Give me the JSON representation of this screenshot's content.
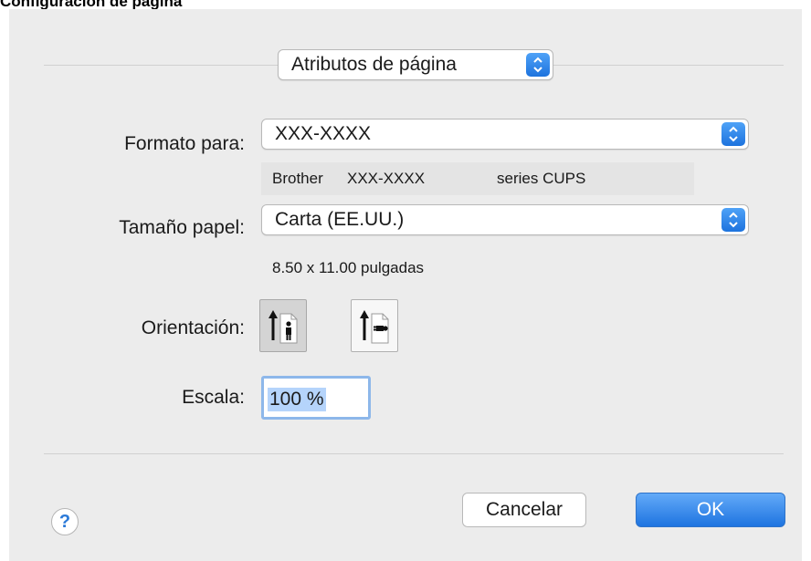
{
  "document": {
    "heading": "Configuración de página"
  },
  "dialog": {
    "attributes_popup": {
      "value": "Atributos de página"
    },
    "format": {
      "label": "Formato para:",
      "value": "XXX-XXXX",
      "printer_description_brand": "Brother",
      "printer_description_model": "XXX-XXXX",
      "printer_description_series": "series CUPS"
    },
    "paper_size": {
      "label": "Tamaño papel:",
      "value": "Carta (EE.UU.)",
      "dimensions": "8.50 x 11.00 pulgadas"
    },
    "orientation": {
      "label": "Orientación:",
      "selected": "portrait",
      "options": [
        "portrait",
        "landscape"
      ]
    },
    "scale": {
      "label": "Escala:",
      "value": "100 %"
    },
    "buttons": {
      "help": "?",
      "cancel": "Cancelar",
      "ok": "OK"
    }
  },
  "colors": {
    "accent": "#1d73de",
    "dialog_background": "#ececec",
    "selection_highlight": "#b5d4fb"
  },
  "icons": [
    "chevron-updown-icon",
    "portrait-orientation-icon",
    "landscape-orientation-icon",
    "help-icon"
  ]
}
